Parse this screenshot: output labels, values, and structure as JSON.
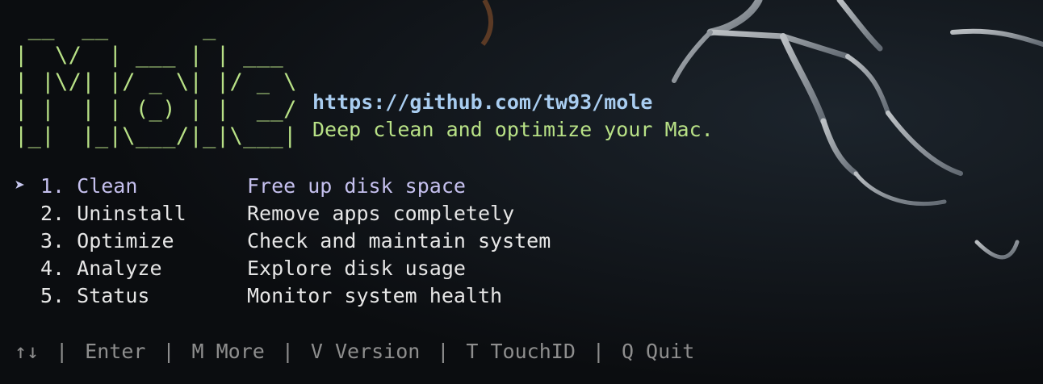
{
  "logo": {
    "ascii": " __  __       _\n|  \\/  | ___ | | ___\n| |\\/| |/ _ \\| |/ _ \\\n| |  | | (_) | |  __/\n|_|  |_|\\___/|_|\\___|"
  },
  "url": "https://github.com/tw93/mole",
  "tagline": "Deep clean and optimize your Mac.",
  "menu": {
    "selected_marker": "➤",
    "items": [
      {
        "label": "1. Clean",
        "description": "Free up disk space"
      },
      {
        "label": "2. Uninstall",
        "description": "Remove apps completely"
      },
      {
        "label": "3. Optimize",
        "description": "Check and maintain system"
      },
      {
        "label": "4. Analyze",
        "description": "Explore disk usage"
      },
      {
        "label": "5. Status",
        "description": "Monitor system health"
      }
    ],
    "selected_index": 0
  },
  "footer": {
    "navigate": "↑↓",
    "separator": "|",
    "enter": "Enter",
    "more": "M More",
    "version": "V Version",
    "touchid": "T TouchID",
    "quit": "Q Quit"
  },
  "colors": {
    "background": "#0d0f12",
    "logo": "#b8e186",
    "url": "#a9cdf0",
    "selected": "#c5c0ee",
    "text": "#e6e6e6",
    "footer": "#8e8e8e"
  }
}
